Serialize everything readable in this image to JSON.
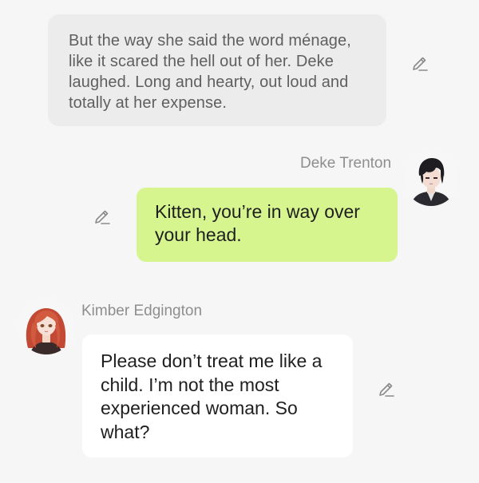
{
  "narration": {
    "text": "But the way she said the word ménage, like it scared the hell out of her. Deke laughed. Long and hearty, out loud and totally at her expense.",
    "edit_icon": "pencil-icon"
  },
  "message_deke": {
    "speaker": "Deke Trenton",
    "text": "Kitten, you’re in way over your head.",
    "bubble_color": "#d6f58f",
    "avatar_icon": "dark-haired-man-avatar",
    "edit_icon": "pencil-icon"
  },
  "message_kimber": {
    "speaker": "Kimber Edgington",
    "text": "Please don’t treat me like a child. I’m not the most experienced woman. So what?",
    "bubble_color": "#ffffff",
    "avatar_icon": "red-haired-woman-avatar",
    "edit_icon": "pencil-icon"
  },
  "colors": {
    "background": "#f6f6f6",
    "narration_bg": "#ececec",
    "speaker_name": "#8e8e8e",
    "icon": "#8a8a8a"
  }
}
